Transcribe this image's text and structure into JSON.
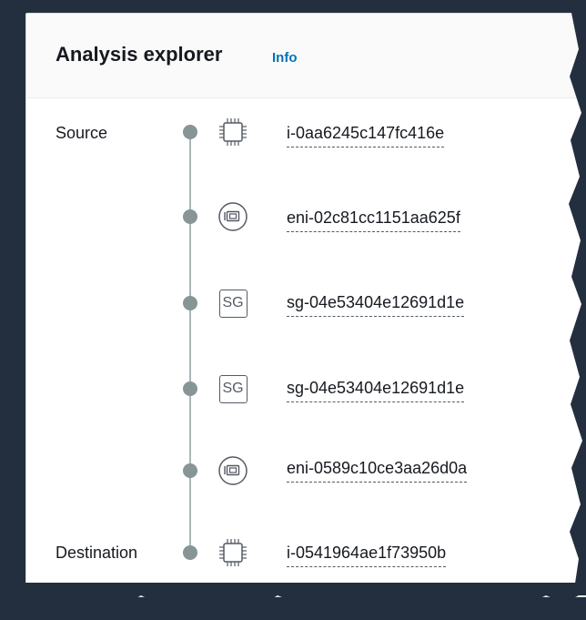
{
  "panel": {
    "title": "Analysis explorer",
    "info_link": "Info"
  },
  "labels": {
    "source": "Source",
    "destination": "Destination"
  },
  "path": [
    {
      "icon": "ec2-instance-icon",
      "resource": "i-0aa6245c147fc416e"
    },
    {
      "icon": "network-interface-icon",
      "resource": "eni-02c81cc1151aa625f"
    },
    {
      "icon": "security-group-icon",
      "badge": "SG",
      "resource": "sg-04e53404e12691d1e"
    },
    {
      "icon": "security-group-icon",
      "badge": "SG",
      "resource": "sg-04e53404e12691d1e"
    },
    {
      "icon": "network-interface-icon",
      "resource": "eni-0589c10ce3aa26d0a"
    },
    {
      "icon": "ec2-instance-icon",
      "resource": "i-0541964ae1f73950b"
    }
  ],
  "colors": {
    "background": "#232f3e",
    "link": "#0073bb",
    "timeline": "#879596"
  }
}
